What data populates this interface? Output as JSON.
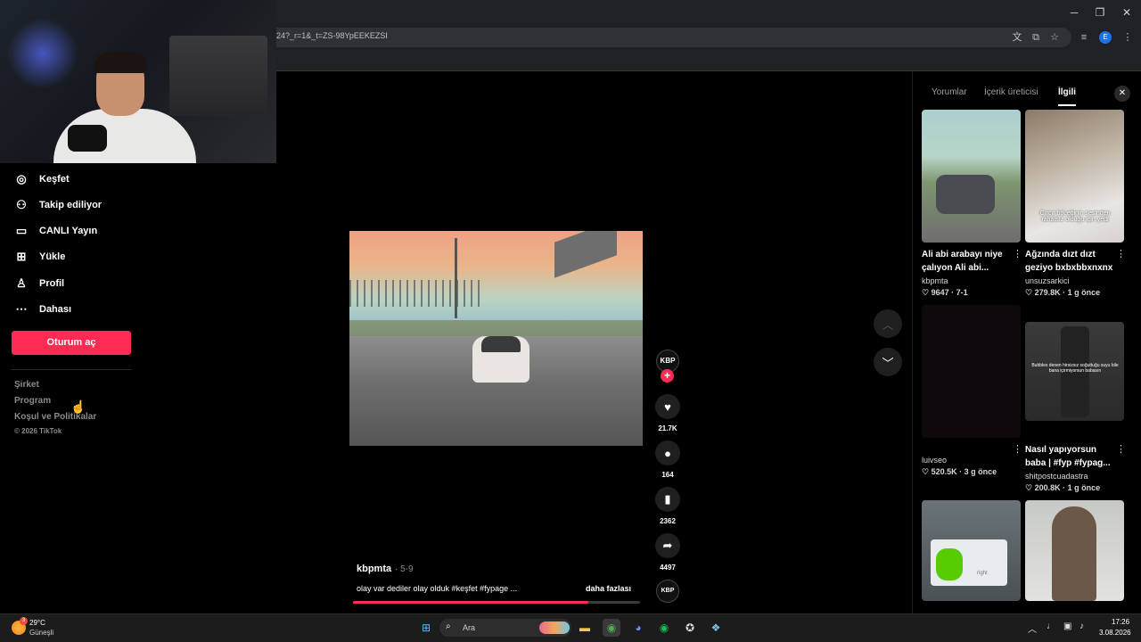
{
  "browser": {
    "url": "24?_r=1&_t=ZS-98YpEEKEZSI",
    "window_controls": [
      "─",
      "❐",
      "✕"
    ],
    "profile_initial": "E"
  },
  "sidebar": {
    "items": [
      {
        "label": "Keşfet",
        "icon": "compass-icon"
      },
      {
        "label": "Takip ediliyor",
        "icon": "following-icon"
      },
      {
        "label": "CANLI Yayın",
        "icon": "live-icon"
      },
      {
        "label": "Yükle",
        "icon": "upload-icon"
      },
      {
        "label": "Profil",
        "icon": "profile-icon"
      },
      {
        "label": "Dahası",
        "icon": "more-icon"
      }
    ],
    "login_label": "Oturum aç",
    "footer_links": [
      "Şirket",
      "Program",
      "Koşul ve Politikalar"
    ],
    "copyright": "© 2026 TikTok"
  },
  "video": {
    "author": "kbpmta",
    "date": "· 5-9",
    "caption": "olay var dediler olay olduk #keşfet #fypage ...",
    "more_label": "daha fazlası",
    "progress": 0.82,
    "avatar_text": "KBP",
    "music_disc_text": "KBP",
    "actions": {
      "likes": "21.7K",
      "comments": "164",
      "saves": "2362",
      "shares": "4497"
    }
  },
  "panel": {
    "tabs": [
      "Yorumlar",
      "İçerik üreticisi",
      "İlgili"
    ],
    "active_tab": "İlgili",
    "cards": [
      {
        "title": "Ali abi arabayı niye çalıyon Ali abi...",
        "author": "kbpmta",
        "likes": "9647",
        "date": "7-1"
      },
      {
        "title": "Ağzında dızt dızt geziyo bxbxbbxnxnx",
        "author": "unsuzsarkici",
        "likes": "279.8K",
        "date": "1 g önce",
        "overlay": "Cırcır böceğinin sesinden rahatsız olduğu için yedi"
      },
      {
        "title": "",
        "author": "luivseo",
        "likes": "520.5K",
        "date": "3 g önce"
      },
      {
        "title": "Nasıl yapıyorsun baba | #fyp #fypag...",
        "author": "shitpostcuadastra",
        "likes": "200.8K",
        "date": "1 g önce",
        "overlay": "Bubbles denen hirsizsız soğuttuğu suyu bile bana içirmiyorsun babasın"
      },
      {
        "title": "",
        "author": "",
        "likes": "",
        "date": "",
        "overlay": "right"
      },
      {
        "title": "",
        "author": "",
        "likes": "",
        "date": ""
      }
    ]
  },
  "taskbar": {
    "weather_temp": "29°C",
    "weather_cond": "Güneşli",
    "weather_badge": "3",
    "search_label": "Ara",
    "time": "17:26",
    "date": "3.08.2026"
  }
}
